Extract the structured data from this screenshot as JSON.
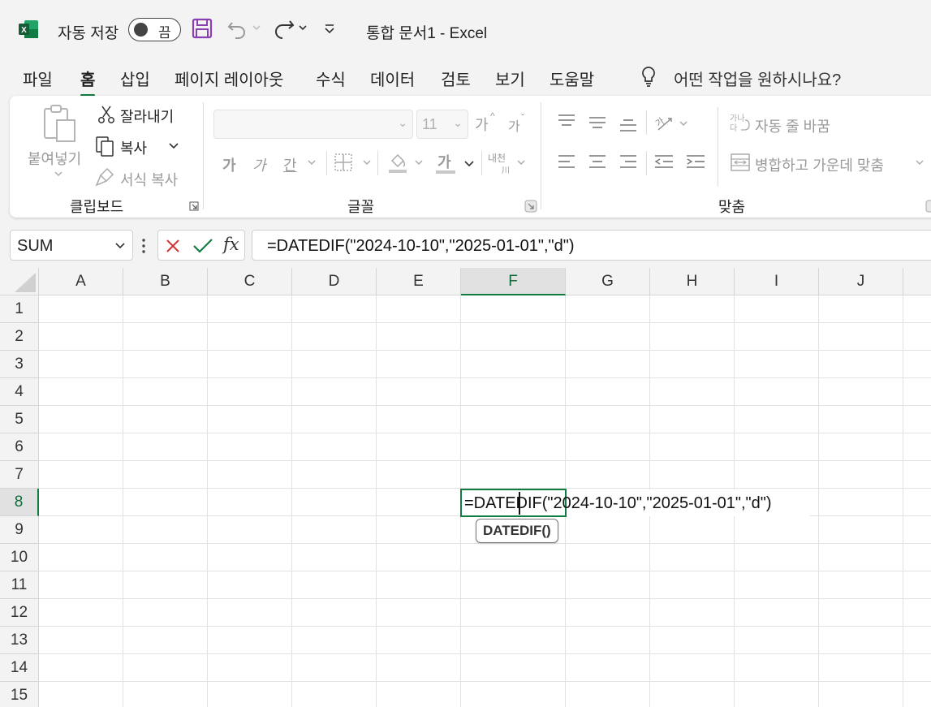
{
  "titlebar": {
    "autosave_label": "자동 저장",
    "autosave_state": "끔",
    "doc_title": "통합 문서1  -  Excel"
  },
  "menu": {
    "tabs": [
      "파일",
      "홈",
      "삽입",
      "페이지 레이아웃",
      "수식",
      "데이터",
      "검토",
      "보기",
      "도움말"
    ],
    "active_tab": "홈",
    "tell_me": "어떤 작업을 원하시나요?"
  },
  "ribbon": {
    "clipboard": {
      "paste": "붙여넣기",
      "cut": "잘라내기",
      "copy": "복사",
      "format_painter": "서식 복사",
      "group_label": "클립보드"
    },
    "font": {
      "font_name": "",
      "font_size": "11",
      "grow": "가",
      "shrink": "가",
      "bold": "가",
      "italic": "가",
      "underline": "간",
      "font_color": "가",
      "phonetic": "내천",
      "group_label": "글꼴"
    },
    "alignment": {
      "wrap_text": "자동 줄 바꿈",
      "merge_center": "병합하고 가운데 맞춤",
      "group_label": "맞춤"
    }
  },
  "formula_bar": {
    "name_box": "SUM",
    "fx": "fx",
    "formula": "=DATEDIF(\"2024-10-10\",\"2025-01-01\",\"d\")"
  },
  "grid": {
    "columns": [
      "A",
      "B",
      "C",
      "D",
      "E",
      "F",
      "G",
      "H",
      "I",
      "J"
    ],
    "rows": [
      "1",
      "2",
      "3",
      "4",
      "5",
      "6",
      "7",
      "8",
      "9",
      "10",
      "11",
      "12",
      "13",
      "14",
      "15"
    ],
    "active_column": "F",
    "active_row": "8",
    "cell_content": "=DATEDIF(\"2024-10-10\",\"2025-01-01\",\"d\")",
    "tooltip": "DATEDIF()"
  },
  "colors": {
    "excel_green": "#107c41",
    "save_purple": "#8a3fb0",
    "cancel_red": "#d13438",
    "enter_green": "#107c41"
  }
}
